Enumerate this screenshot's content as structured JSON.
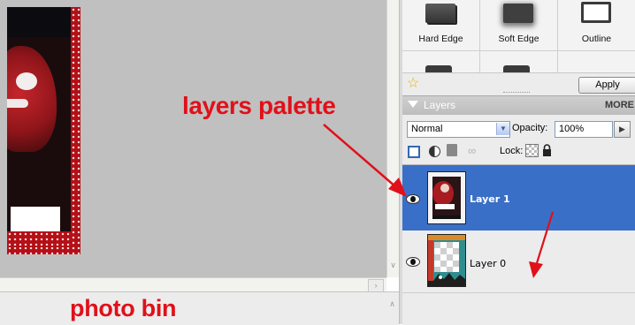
{
  "annotations": {
    "layers_palette": "layers palette",
    "photo_bin": "photo bin"
  },
  "effects": {
    "items": [
      {
        "label": "Hard Edge"
      },
      {
        "label": "Soft Edge"
      },
      {
        "label": "Outline"
      }
    ],
    "apply_label": "Apply"
  },
  "layers_panel": {
    "title": "Layers",
    "more_label": "MORE",
    "blend_mode": "Normal",
    "opacity_label": "Opacity:",
    "opacity_value": "100%",
    "lock_label": "Lock:",
    "layers": [
      {
        "name": "Layer 1",
        "selected": true,
        "visible": true
      },
      {
        "name": "Layer 0",
        "selected": false,
        "visible": true
      }
    ]
  },
  "colors": {
    "annotation": "#e0101a",
    "selection": "#3a6fc7"
  }
}
